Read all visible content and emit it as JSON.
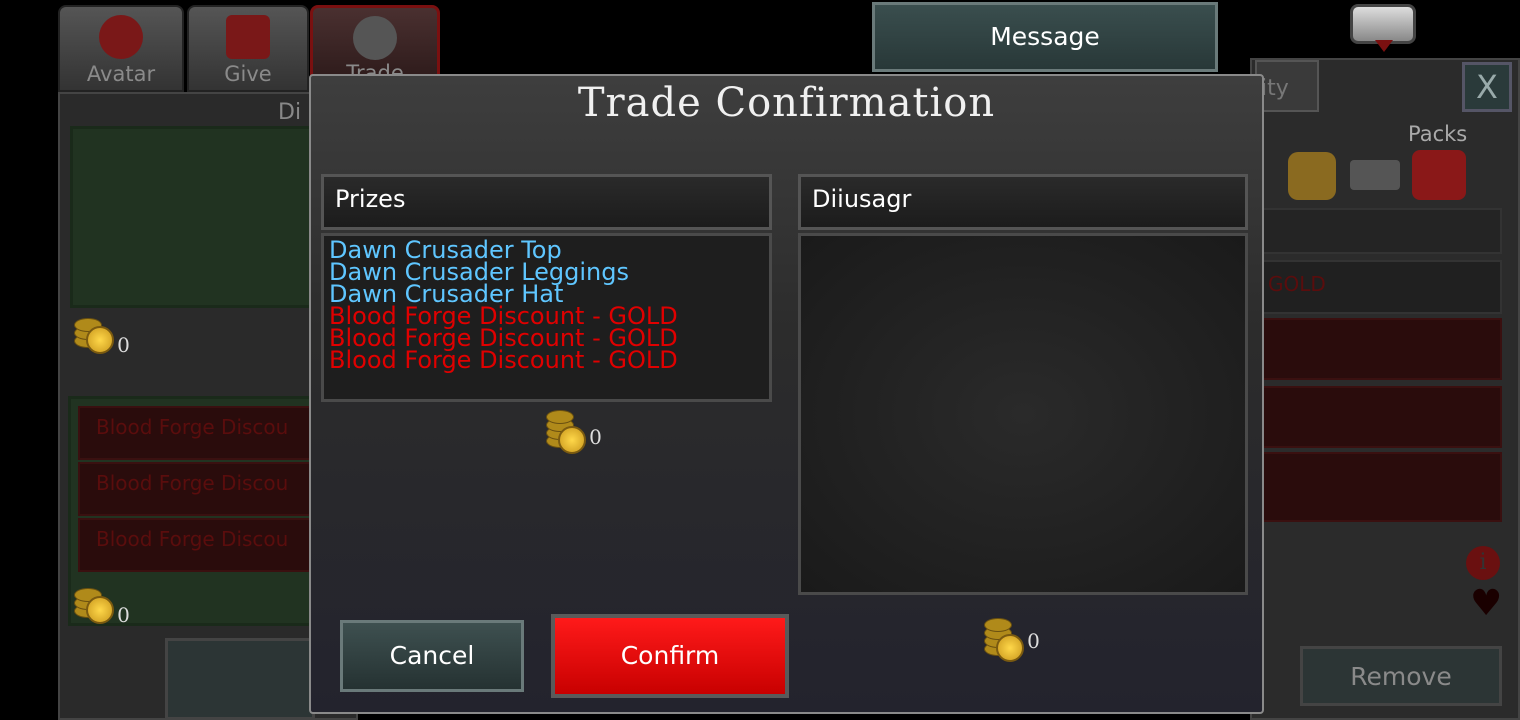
{
  "background": {
    "tabs": [
      {
        "label": "Avatar",
        "icon": "avatar-icon"
      },
      {
        "label": "Give",
        "icon": "gift-icon"
      },
      {
        "label": "Trade",
        "icon": "scales-icon"
      }
    ],
    "message_label": "Message",
    "close_label": "X",
    "packs_label": "Packs",
    "remove_label": "Remove",
    "left_rows": [
      "Blood Forge Discou",
      "Blood Forge Discou",
      "Blood Forge Discou"
    ],
    "left_coin_top": "0",
    "left_coin_bottom": "0",
    "right_partial_tab": "ity",
    "right_partial_row": "GOLD"
  },
  "modal": {
    "title": "Trade Confirmation",
    "left": {
      "header": "Prizes",
      "items": [
        {
          "name": "Dawn Crusader Top",
          "color": "#5fc6ff"
        },
        {
          "name": "Dawn Crusader Leggings",
          "color": "#5fc6ff"
        },
        {
          "name": "Dawn Crusader Hat",
          "color": "#5fc6ff"
        },
        {
          "name": "Blood Forge Discount - GOLD",
          "color": "#e00000"
        },
        {
          "name": "Blood Forge Discount - GOLD",
          "color": "#e00000"
        },
        {
          "name": "Blood Forge Discount - GOLD",
          "color": "#e00000"
        }
      ],
      "coins": "0"
    },
    "right": {
      "header": "Diiusagr",
      "coins": "0"
    },
    "cancel_label": "Cancel",
    "confirm_label": "Confirm"
  }
}
